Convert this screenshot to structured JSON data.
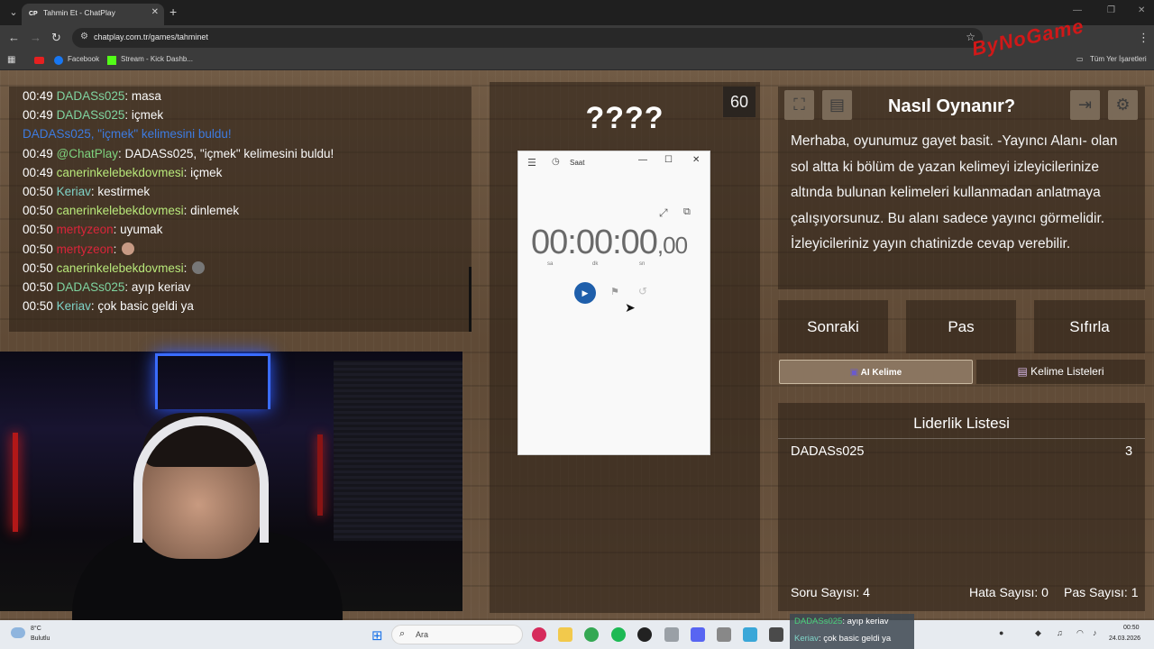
{
  "browser": {
    "tab_title": "Tahmin Et - ChatPlay",
    "tab_favicon": "CP",
    "url": "chatplay.com.tr/games/tahminet",
    "bookmarks": [
      "Facebook",
      "Stream - Kick Dashb..."
    ],
    "all_bookmarks": "Tüm Yer İşaretleri"
  },
  "overlay_logo": "ByNoGame",
  "chat": {
    "messages": [
      {
        "time": "00:49",
        "user": "DADASs025",
        "text": ": masa",
        "color": "#7fd4a0"
      },
      {
        "time": "00:49",
        "user": "DADASs025",
        "text": ": içmek",
        "color": "#7fd4a0"
      },
      {
        "time": "",
        "user": "DADASs025, \"içmek\" kelimesini buldu!",
        "text": "",
        "color": "#3d7be0"
      },
      {
        "time": "00:49",
        "user": "@ChatPlay",
        "text": ": DADASs025, \"içmek\" kelimesini buldu!",
        "color": "#7fd47f"
      },
      {
        "time": "00:49",
        "user": "canerinkelebekdovmesi",
        "text": ": içmek",
        "color": "#b8e87a"
      },
      {
        "time": "00:50",
        "user": "Keriav",
        "text": ": kestirmek",
        "color": "#7fd4c8"
      },
      {
        "time": "00:50",
        "user": "canerinkelebekdovmesi",
        "text": ": dinlemek",
        "color": "#b8e87a"
      },
      {
        "time": "00:50",
        "user": "mertyzeon",
        "text": ": uyumak",
        "color": "#d9253a"
      },
      {
        "time": "00:50",
        "user": "mertyzeon",
        "text": ":",
        "color": "#d9253a"
      },
      {
        "time": "00:50",
        "user": "canerinkelebekdovmesi",
        "text": ":",
        "color": "#b8e87a"
      },
      {
        "time": "00:50",
        "user": "DADASs025",
        "text": ": ayıp keriav",
        "color": "#7fd4a0"
      },
      {
        "time": "00:50",
        "user": "Keriav",
        "text": ": çok basic geldi ya",
        "color": "#7fd4c8"
      }
    ]
  },
  "game": {
    "timer": "60",
    "question": "????"
  },
  "clock_app": {
    "title": "Saat",
    "time": "00:00:00",
    "ms": ",00",
    "units": [
      "sa",
      "dk",
      "sn"
    ]
  },
  "howto": {
    "title": "Nasıl Oynanır?",
    "text": "Merhaba, oyunumuz gayet basit. -Yayıncı Alanı- olan sol altta ki bölüm de yazan kelimeyi izleyicilerinize altında bulunan kelimeleri kullanmadan anlatmaya çalışıyorsunuz. Bu alanı sadece yayıncı görmelidir. İzleyicileriniz yayın chatinizde cevap verebilir."
  },
  "actions": {
    "next": "Sonraki",
    "pass": "Pas",
    "reset": "Sıfırla",
    "ai_tab": "AI Kelime",
    "lists_tab": "Kelime Listeleri"
  },
  "leaderboard": {
    "title": "Liderlik Listesi",
    "rows": [
      {
        "name": "DADASs025",
        "score": "3"
      }
    ]
  },
  "stats": {
    "questions": "Soru Sayısı: 4",
    "errors": "Hata Sayısı: 0",
    "passes": "Pas Sayısı: 1"
  },
  "taskbar": {
    "temp": "8°C",
    "weather": "Bulutlu",
    "search": "Ara",
    "time": "00:50",
    "date": "24.03.2026"
  },
  "overlay_chat": [
    {
      "user": "DADASs025",
      "text": ": ayıp keriav",
      "color": "#4ad07a"
    },
    {
      "user": "Keriav",
      "text": ": çok basic geldi ya",
      "color": "#7fd4c8"
    }
  ]
}
